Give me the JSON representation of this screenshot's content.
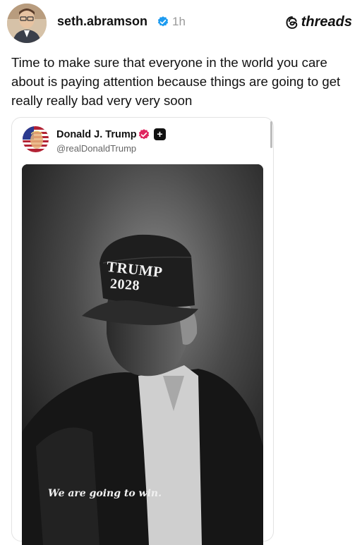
{
  "post": {
    "author": "seth.abramson",
    "time": "1h",
    "text": "Time to make sure that everyone in the world you care about is paying attention because things are going to get really really bad very very soon"
  },
  "brand": {
    "name": "threads",
    "icon": "threads-logo-icon"
  },
  "embed": {
    "name": "Donald J. Trump",
    "handle": "@realDonaldTrump",
    "plus_label": "+",
    "image": {
      "hat_line1": "TRUMP",
      "hat_line2": "2028",
      "caption": "We are going to win."
    }
  },
  "colors": {
    "verified_blue": "#1d9bf0",
    "embed_badge_pink": "#e0245e",
    "text": "#111111",
    "muted": "#9a9a9a"
  }
}
